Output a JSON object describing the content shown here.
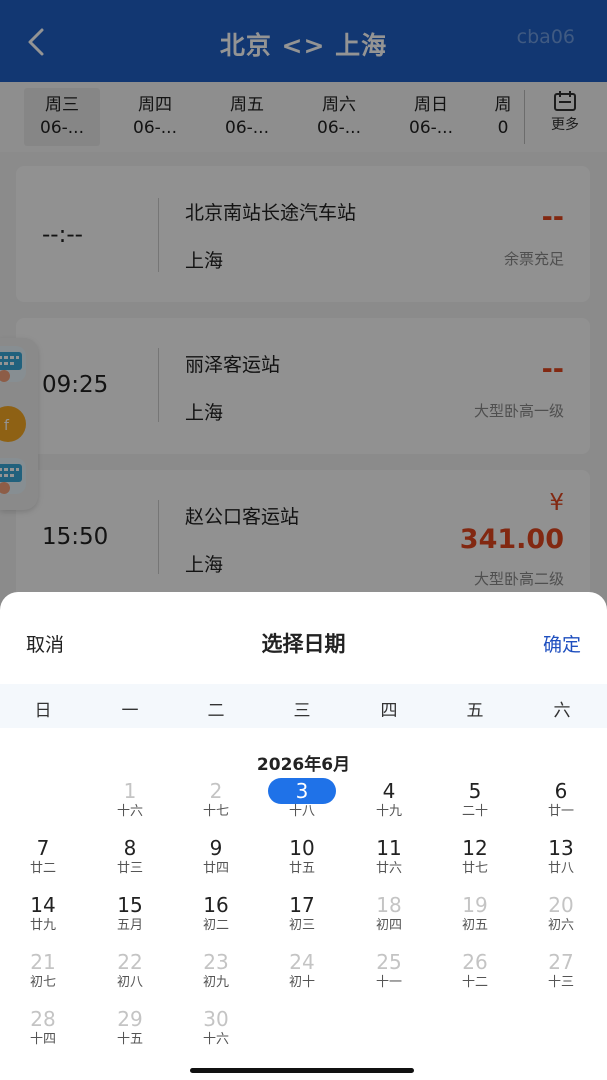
{
  "header": {
    "title": "北京 <> 上海",
    "user": "cba06"
  },
  "date_tabs": [
    {
      "week": "周三",
      "date": "06-...",
      "active": true
    },
    {
      "week": "周四",
      "date": "06-..."
    },
    {
      "week": "周五",
      "date": "06-..."
    },
    {
      "week": "周六",
      "date": "06-..."
    },
    {
      "week": "周日",
      "date": "06-..."
    },
    {
      "week": "周",
      "date": "0"
    }
  ],
  "more_label": "更多",
  "trips": [
    {
      "time": "--:--",
      "from": "北京南站长途汽车站",
      "to": "上海",
      "price": "--",
      "note": "余票充足"
    },
    {
      "time": "09:25",
      "from": "丽泽客运站",
      "to": "上海",
      "price": "--",
      "note": "大型卧高一级"
    },
    {
      "time": "15:50",
      "from": "赵公口客运站",
      "to": "上海",
      "price_symbol": "¥",
      "price": "341.00",
      "note": "大型卧高二级"
    }
  ],
  "picker": {
    "cancel": "取消",
    "title": "选择日期",
    "confirm": "确定",
    "weekdays": [
      "日",
      "一",
      "二",
      "三",
      "四",
      "五",
      "六"
    ],
    "month": "2026年6月",
    "days": [
      {
        "d": "1",
        "l": "十六",
        "dis": true
      },
      {
        "d": "2",
        "l": "十七",
        "dis": true
      },
      {
        "d": "3",
        "l": "十八",
        "sel": true
      },
      {
        "d": "4",
        "l": "十九"
      },
      {
        "d": "5",
        "l": "二十"
      },
      {
        "d": "6",
        "l": "廿一"
      },
      {
        "d": "7",
        "l": "廿二"
      },
      {
        "d": "8",
        "l": "廿三"
      },
      {
        "d": "9",
        "l": "廿四"
      },
      {
        "d": "10",
        "l": "廿五"
      },
      {
        "d": "11",
        "l": "廿六"
      },
      {
        "d": "12",
        "l": "廿七"
      },
      {
        "d": "13",
        "l": "廿八"
      },
      {
        "d": "14",
        "l": "廿九"
      },
      {
        "d": "15",
        "l": "五月"
      },
      {
        "d": "16",
        "l": "初二"
      },
      {
        "d": "17",
        "l": "初三"
      },
      {
        "d": "18",
        "l": "初四",
        "dis": true
      },
      {
        "d": "19",
        "l": "初五",
        "dis": true
      },
      {
        "d": "20",
        "l": "初六",
        "dis": true
      },
      {
        "d": "21",
        "l": "初七",
        "dis": true
      },
      {
        "d": "22",
        "l": "初八",
        "dis": true
      },
      {
        "d": "23",
        "l": "初九",
        "dis": true
      },
      {
        "d": "24",
        "l": "初十",
        "dis": true
      },
      {
        "d": "25",
        "l": "十一",
        "dis": true
      },
      {
        "d": "26",
        "l": "十二",
        "dis": true
      },
      {
        "d": "27",
        "l": "十三",
        "dis": true
      },
      {
        "d": "28",
        "l": "十四",
        "dis": true
      },
      {
        "d": "29",
        "l": "十五",
        "dis": true
      },
      {
        "d": "30",
        "l": "十六",
        "dis": true
      }
    ]
  },
  "colors": {
    "header_bg": "#1f5fc4",
    "accent": "#1f72e8",
    "price": "#e0461e",
    "confirm": "#1f4fbf"
  }
}
